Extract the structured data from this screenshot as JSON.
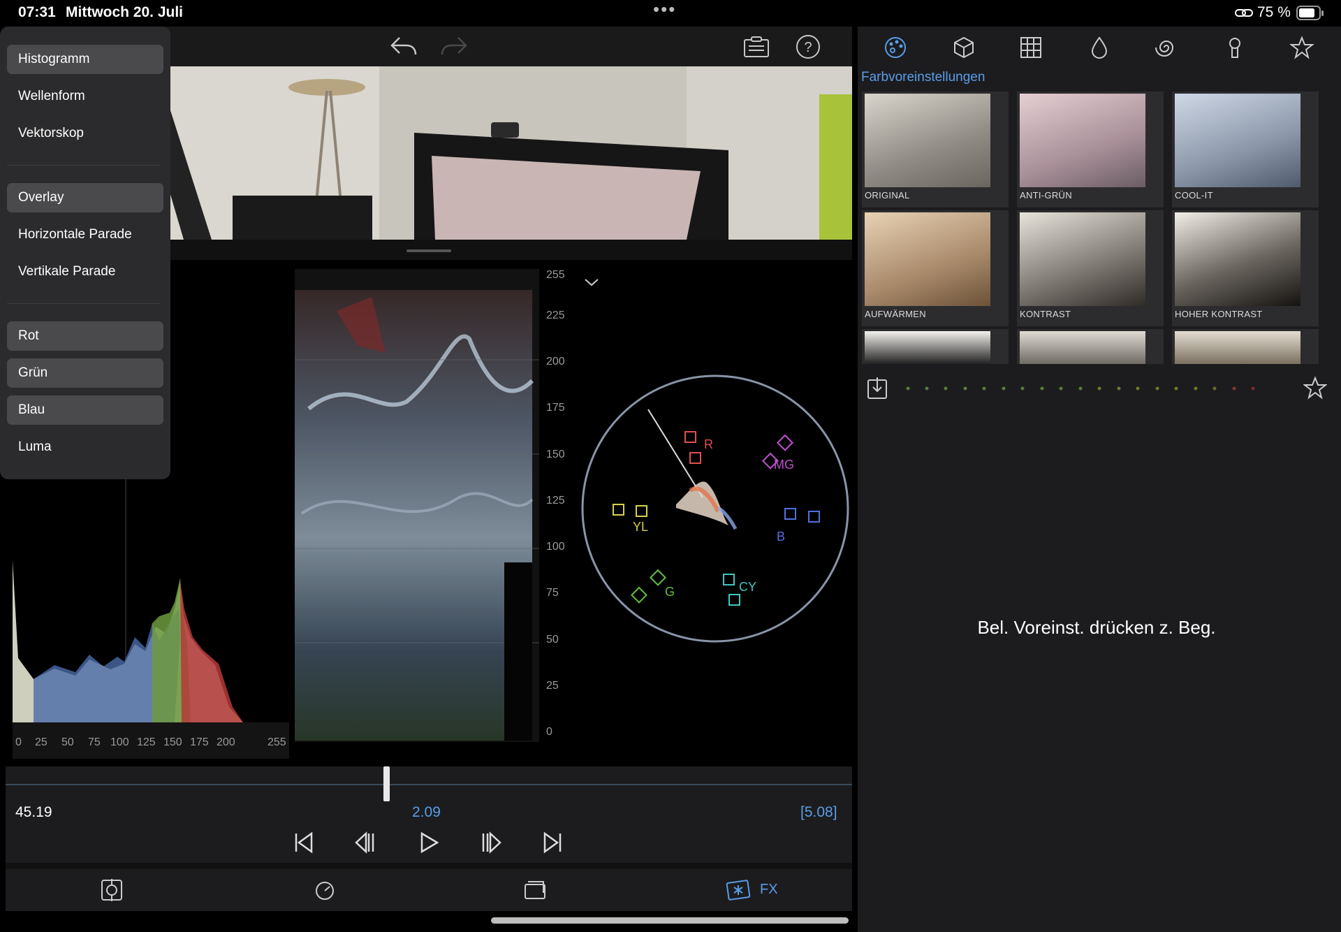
{
  "status_bar": {
    "time": "07:31",
    "date": "Mittwoch 20. Juli",
    "dots": "•••",
    "battery": "75 %"
  },
  "scope_menu": {
    "group1": [
      {
        "label": "Histogramm",
        "selected": true
      },
      {
        "label": "Wellenform",
        "selected": false
      },
      {
        "label": "Vektorskop",
        "selected": false
      }
    ],
    "group2": [
      {
        "label": "Overlay",
        "selected": true
      },
      {
        "label": "Horizontale Parade",
        "selected": false
      },
      {
        "label": "Vertikale Parade",
        "selected": false
      }
    ],
    "group3": [
      {
        "label": "Rot",
        "selected": true
      },
      {
        "label": "Grün",
        "selected": true
      },
      {
        "label": "Blau",
        "selected": true
      },
      {
        "label": "Luma",
        "selected": false
      }
    ]
  },
  "histogram": {
    "x_ticks": [
      "0",
      "25",
      "50",
      "75",
      "100",
      "125",
      "150",
      "175",
      "200",
      "255"
    ]
  },
  "waveform": {
    "y_ticks": [
      "255",
      "225",
      "200",
      "175",
      "150",
      "125",
      "100",
      "75",
      "50",
      "25",
      "0"
    ]
  },
  "vectorscope": {
    "labels": {
      "r": "R",
      "mg": "MG",
      "yl": "YL",
      "b": "B",
      "g": "G",
      "cy": "CY"
    }
  },
  "timeline": {
    "left": "45.19",
    "center": "2.09",
    "right": "[5.08]",
    "playhead_fraction": 0.45
  },
  "bottom_tools": {
    "fx_label": "FX"
  },
  "presets": {
    "title": "Farbvoreinstellungen",
    "items": [
      {
        "name": "ORIGINAL"
      },
      {
        "name": "ANTI-GRÜN"
      },
      {
        "name": "COOL-IT"
      },
      {
        "name": "AUFWÄRMEN"
      },
      {
        "name": "KONTRAST"
      },
      {
        "name": "HOHER KONTRAST"
      }
    ],
    "hint": "Bel. Voreinst. drücken z. Beg."
  },
  "colors": {
    "accent": "#5a9de8",
    "menu_selected": "#4a4a4d",
    "panel_bg": "#1c1c1e"
  },
  "icons": [
    "undo-icon",
    "redo-icon",
    "clipboard-icon",
    "help-icon",
    "palette-icon",
    "cube-icon",
    "grid-icon",
    "drop-icon",
    "spiral-icon",
    "keyhole-icon",
    "star-icon",
    "import-icon",
    "favorite-star-icon",
    "target-icon",
    "speedometer-icon",
    "crop-icon",
    "fx-icon",
    "skip-start-icon",
    "step-back-icon",
    "play-icon",
    "step-forward-icon",
    "skip-end-icon",
    "chevron-down-icon"
  ]
}
